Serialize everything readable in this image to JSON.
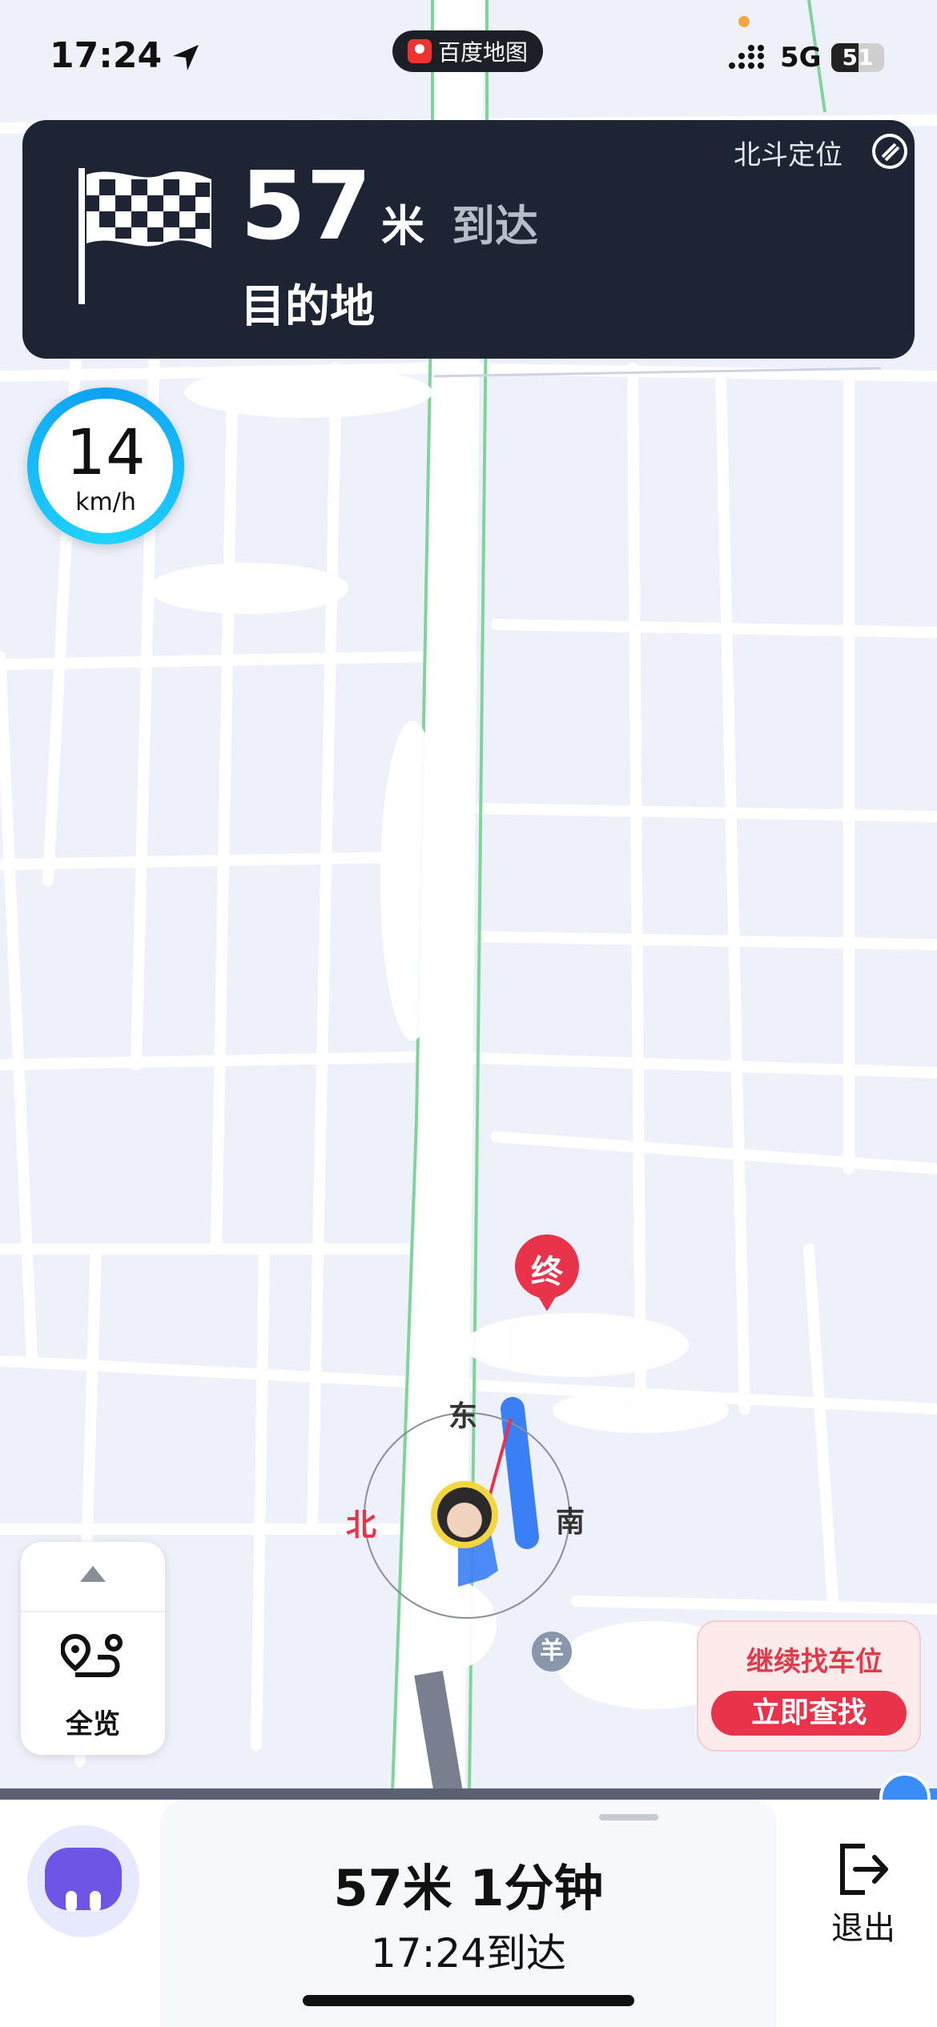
{
  "status_bar": {
    "time": "17:24",
    "app_name": "百度地图",
    "network": "5G",
    "battery": "51"
  },
  "nav_card": {
    "distance_value": "57",
    "distance_unit": "米",
    "arrive_text": "到达",
    "destination": "目的地",
    "positioning": "北斗定位"
  },
  "speed": {
    "value": "14",
    "unit": "km/h"
  },
  "map": {
    "end_marker": "终",
    "compass": {
      "east": "东",
      "north": "北",
      "south": "南"
    },
    "poi_marker": "羊",
    "colors": {
      "route": "#3a7ff6",
      "road_edge": "#7fd49a",
      "end": "#e8334a"
    }
  },
  "overview_button": {
    "label": "全览"
  },
  "parking_card": {
    "title": "继续找车位",
    "button": "立即查找"
  },
  "bottom_panel": {
    "summary": "57米 1分钟",
    "eta": "17:24到达",
    "exit_label": "退出"
  }
}
